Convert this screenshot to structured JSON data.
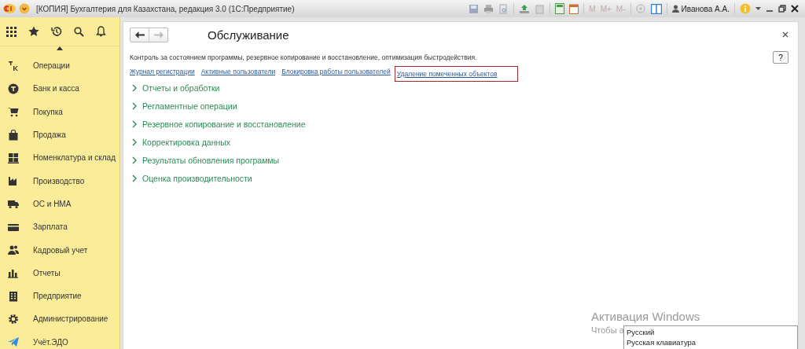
{
  "window": {
    "title": "[КОПИЯ] Бухгалтерия для Казахстана, редакция 3.0  (1С:Предприятие)",
    "user": "Иванова А.А.",
    "memory_buttons": [
      "M",
      "M+",
      "M-"
    ]
  },
  "sidebar": {
    "items": [
      {
        "label": "Операции"
      },
      {
        "label": "Банк и касса"
      },
      {
        "label": "Покупка"
      },
      {
        "label": "Продажа"
      },
      {
        "label": "Номенклатура и склад"
      },
      {
        "label": "Производство"
      },
      {
        "label": "ОС и НМА"
      },
      {
        "label": "Зарплата"
      },
      {
        "label": "Кадровый учет"
      },
      {
        "label": "Отчеты"
      },
      {
        "label": "Предприятие"
      },
      {
        "label": "Администрирование"
      },
      {
        "label": "Учёт.ЭДО"
      }
    ]
  },
  "form": {
    "title": "Обслуживание",
    "description": "Контроль за состоянием программы, резервное копирование и восстановление, оптимизация быстродействия.",
    "help": "?",
    "links": [
      {
        "label": "Журнал регистрации",
        "highlighted": false
      },
      {
        "label": "Активные пользователи",
        "highlighted": false
      },
      {
        "label": "Блокировка работы пользователей",
        "highlighted": false
      },
      {
        "label": "Удаление помеченных объектов",
        "highlighted": true
      }
    ],
    "groups": [
      {
        "label": "Отчеты и обработки",
        "expanded": false
      },
      {
        "label": "Регламентные операции",
        "expanded": false
      },
      {
        "label": "Резервное копирование и восстановление",
        "expanded": false
      },
      {
        "label": "Корректировка данных",
        "expanded": false
      },
      {
        "label": "Результаты обновления программы",
        "expanded": false
      },
      {
        "label": "Оценка производительности",
        "expanded": false
      }
    ]
  },
  "activation": {
    "title": "Активация Windows",
    "line_start": "Чтобы а"
  },
  "tooltip": {
    "lines": [
      "Русский",
      "Русская клавиатура"
    ]
  }
}
